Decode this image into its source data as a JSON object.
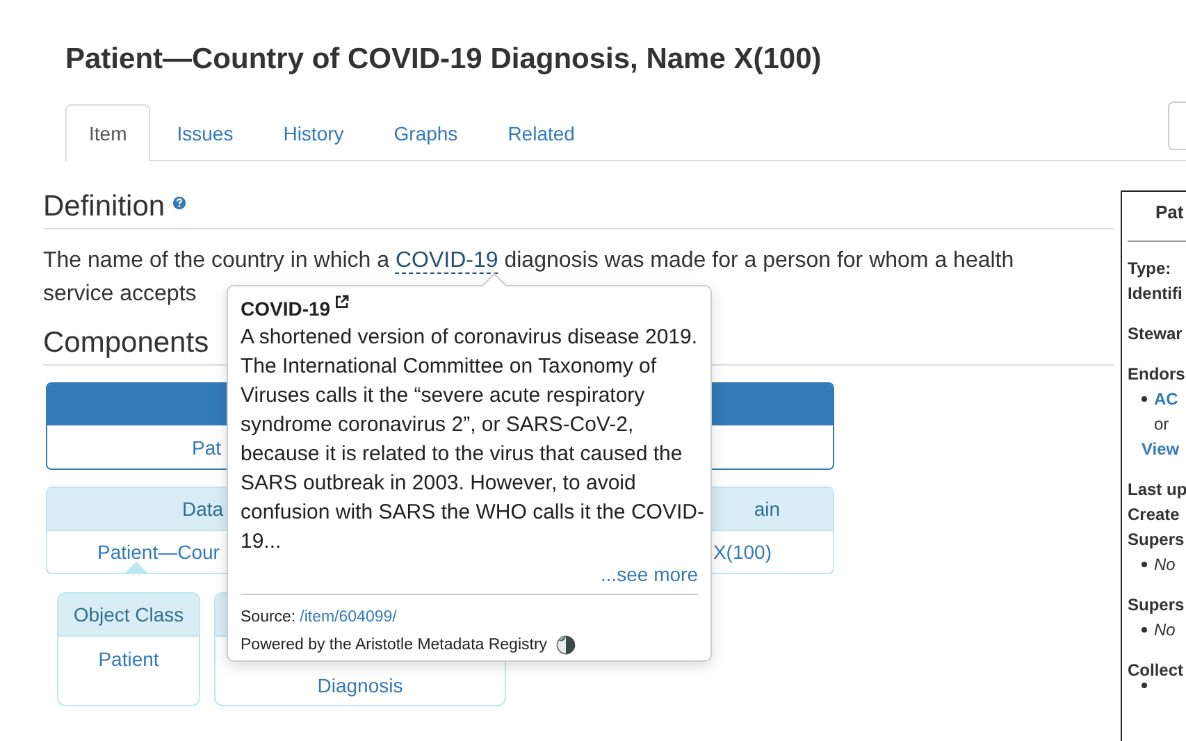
{
  "title": "Patient—Country of COVID-19 Diagnosis, Name X(100)",
  "tabs": [
    {
      "label": "Item",
      "selected": true
    },
    {
      "label": "Issues",
      "selected": false
    },
    {
      "label": "History",
      "selected": false
    },
    {
      "label": "Graphs",
      "selected": false
    },
    {
      "label": "Related",
      "selected": false
    }
  ],
  "definition": {
    "heading": "Definition",
    "text_before": "The name of the country in which a ",
    "link": "COVID-19",
    "text_after": " diagnosis was made for a person for whom a health service accepts"
  },
  "components": {
    "heading": "Components",
    "data_element": {
      "value": "Pat"
    },
    "dec": {
      "header_left": "Data",
      "header_right": "ain",
      "value_left": "Patient—Cour",
      "value_right": "X(100)"
    },
    "object_class": {
      "header": "Object Class",
      "value": "Patient"
    },
    "property": {
      "value": "Diagnosis"
    }
  },
  "popover": {
    "title": "COVID-19",
    "text": "A shortened version of coronavirus disease 2019. The International Committee on Taxonomy of Viruses calls it the “severe acute respiratory syndrome coronavirus 2”, or SARS-CoV-2, because it is related to the virus that caused the SARS outbreak in 2003. However, to avoid confusion with SARS the WHO calls it the COVID-19...",
    "see_more": "...see more",
    "source_label": "Source:",
    "source_link": "/item/604099/",
    "powered_by": "Powered by the Aristotle Metadata Registry"
  },
  "sidebar": {
    "title": "Pat",
    "groups": [
      [
        {
          "kind": "label",
          "text": "Type:"
        },
        {
          "kind": "label",
          "text": "Identifi"
        }
      ],
      [
        {
          "kind": "label",
          "text": "Stewar"
        }
      ],
      [
        {
          "kind": "label",
          "text": "Endors"
        },
        {
          "kind": "bullet-link",
          "text": "AC"
        },
        {
          "kind": "text",
          "text": "or"
        },
        {
          "kind": "link",
          "text": "View"
        }
      ],
      [
        {
          "kind": "label",
          "text": "Last up"
        },
        {
          "kind": "label",
          "text": "Create"
        },
        {
          "kind": "label",
          "text": "Supers"
        },
        {
          "kind": "bullet-italic",
          "text": "No"
        }
      ],
      [
        {
          "kind": "label",
          "text": "Supers"
        },
        {
          "kind": "bullet-italic",
          "text": "No"
        }
      ],
      [
        {
          "kind": "label",
          "text": "Collect"
        },
        {
          "kind": "bullet"
        }
      ]
    ]
  }
}
